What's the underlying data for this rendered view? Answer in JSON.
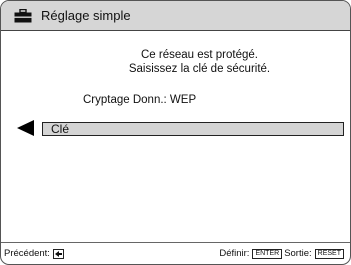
{
  "window": {
    "title": "Réglage simple",
    "icon": "toolbox-icon"
  },
  "message": {
    "line1": "Ce réseau est protégé.",
    "line2": "Saisissez la clé de sécurité."
  },
  "encryption": {
    "text": "Cryptage Donn.: WEP"
  },
  "key_field": {
    "label": "Clé",
    "selector_icon": "left-arrow-icon"
  },
  "footer": {
    "previous_label": "Précédent:",
    "previous_icon": "back-arrow-icon",
    "define_label": "Définir:",
    "enter_key": "ENTER",
    "exit_label": "Sortie:",
    "reset_key": "RESET"
  }
}
